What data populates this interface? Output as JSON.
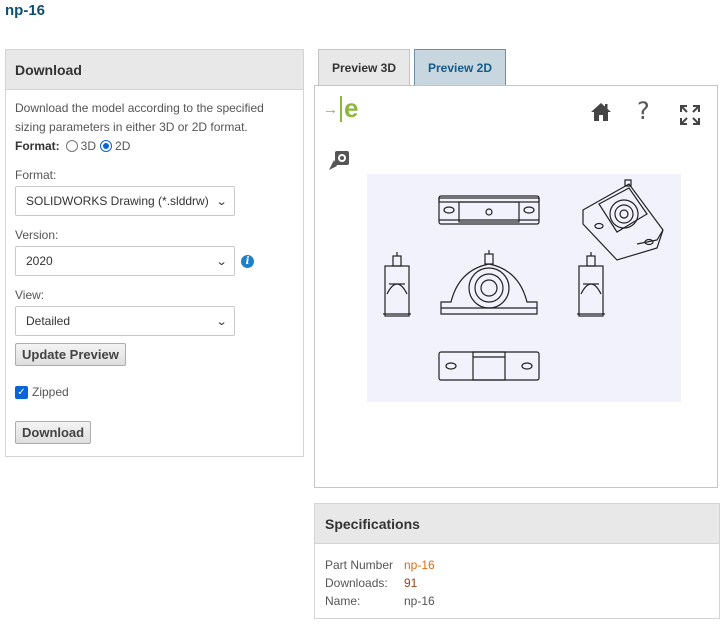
{
  "page": {
    "title": "np-16"
  },
  "download": {
    "header": "Download",
    "description": "Download the model according to the specified sizing parameters in either 3D or 2D format.",
    "format_label": "Format:",
    "format_options": [
      "3D",
      "2D"
    ],
    "format_selected": "2D",
    "file_format_label": "Format:",
    "file_format_value": "SOLIDWORKS Drawing (*.slddrw)",
    "version_label": "Version:",
    "version_value": "2020",
    "view_label": "View:",
    "view_value": "Detailed",
    "update_preview_label": "Update Preview",
    "zipped_label": "Zipped",
    "zipped_checked": true,
    "download_button_label": "Download"
  },
  "tabs": [
    {
      "label": "Preview 3D",
      "active": false
    },
    {
      "label": "Preview 2D",
      "active": true
    }
  ],
  "preview": {
    "logo_letter": "e",
    "toolbar_icons": [
      "home-icon",
      "help-icon",
      "fullscreen-icon",
      "cursor-tool-icon"
    ],
    "help_glyph": "?"
  },
  "specifications": {
    "header": "Specifications",
    "rows": [
      {
        "key": "Part Number",
        "value": "np-16"
      },
      {
        "key": "Downloads:",
        "value": "91"
      },
      {
        "key": "Name:",
        "value": "np-16"
      }
    ]
  },
  "colors": {
    "title": "#0b4f73",
    "accent": "#8cb83e",
    "link": "#e36a12",
    "tab_active": "#c8d6e0"
  }
}
